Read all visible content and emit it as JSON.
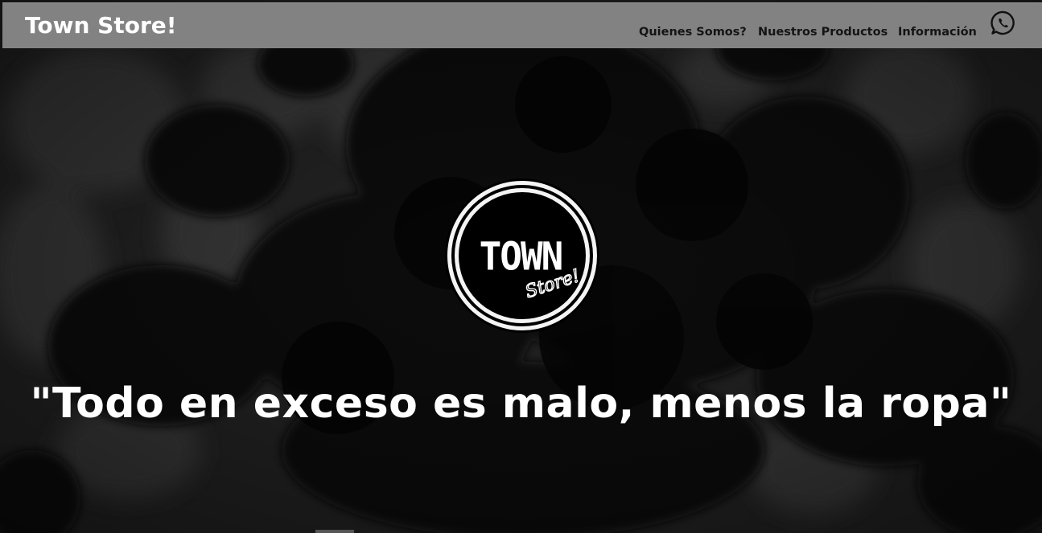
{
  "header": {
    "brand": "Town Store!",
    "nav": [
      {
        "label": "Quienes Somos?"
      },
      {
        "label": "Nuestros Productos"
      },
      {
        "label": "Información"
      }
    ],
    "whatsapp_icon": "whatsapp-icon"
  },
  "hero": {
    "logo": {
      "main_text": "TOWN",
      "script_text": "Store!"
    },
    "tagline": "\"Todo en exceso es malo, menos la ropa\""
  },
  "colors": {
    "navbar_bg": "#828282",
    "nav_text": "#141414",
    "brand_text": "#ffffff",
    "hero_overlay": "#000000"
  }
}
